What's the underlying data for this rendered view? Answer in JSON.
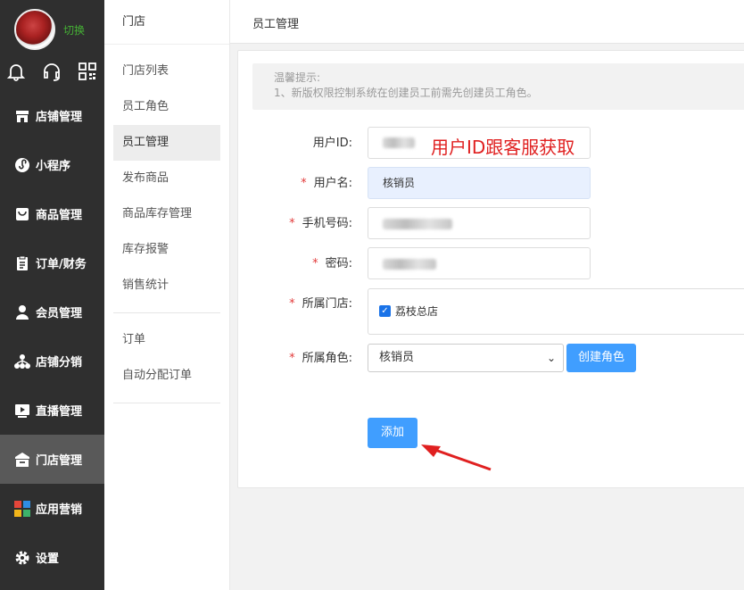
{
  "sidebar": {
    "switch_label": "切换",
    "items": [
      {
        "label": "店铺管理",
        "icon": "store-icon"
      },
      {
        "label": "小程序",
        "icon": "miniprogram-icon"
      },
      {
        "label": "商品管理",
        "icon": "bag-icon"
      },
      {
        "label": "订单/财务",
        "icon": "clipboard-icon"
      },
      {
        "label": "会员管理",
        "icon": "user-icon"
      },
      {
        "label": "店铺分销",
        "icon": "network-icon"
      },
      {
        "label": "直播管理",
        "icon": "play-icon"
      },
      {
        "label": "门店管理",
        "icon": "shop-icon",
        "active": true
      },
      {
        "label": "应用营销",
        "icon": "apps-icon"
      },
      {
        "label": "设置",
        "icon": "gear-icon"
      }
    ]
  },
  "submenu": {
    "title": "门店",
    "group1": [
      "门店列表",
      "员工角色",
      "员工管理",
      "发布商品",
      "商品库存管理",
      "库存报警",
      "销售统计"
    ],
    "group2": [
      "订单",
      "自动分配订单"
    ]
  },
  "header": {
    "title": "员工管理"
  },
  "tip": {
    "line1": "温馨提示:",
    "line2": "1、新版权限控制系统在创建员工前需先创建员工角色。"
  },
  "form": {
    "user_id_label": "用户ID:",
    "annotation": "用户ID跟客服获取",
    "username_label": "用户名:",
    "username_value": "核销员",
    "phone_label": "手机号码:",
    "password_label": "密码:",
    "store_label": "所属门店:",
    "store_option": "荔枝总店",
    "role_label": "所属角色:",
    "role_value": "核销员",
    "create_role_button": "创建角色",
    "add_button": "添加",
    "required_mark": "*",
    "accent_color": "#409eff",
    "annotation_color": "#e02020"
  }
}
